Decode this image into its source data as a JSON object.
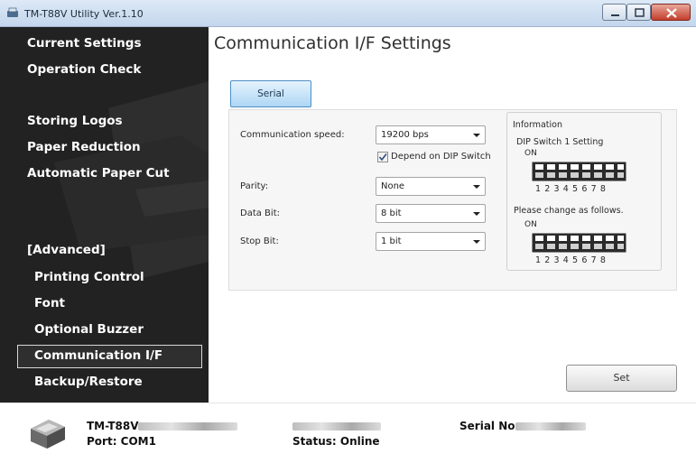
{
  "window": {
    "title": "TM-T88V Utility Ver.1.10"
  },
  "sidebar": {
    "items": [
      {
        "label": "Current Settings"
      },
      {
        "label": "Operation Check"
      },
      {
        "label": "Storing Logos"
      },
      {
        "label": "Paper Reduction"
      },
      {
        "label": "Automatic Paper Cut"
      },
      {
        "label": "[Advanced]"
      },
      {
        "label": "Printing Control"
      },
      {
        "label": "Font"
      },
      {
        "label": "Optional Buzzer"
      },
      {
        "label": "Communication I/F",
        "selected": true
      },
      {
        "label": "Backup/Restore"
      }
    ]
  },
  "main": {
    "title": "Communication I/F Settings",
    "tab": "Serial",
    "fields": {
      "speed": {
        "label": "Communication speed:",
        "value": "19200 bps"
      },
      "depend_dip": {
        "label": "Depend on DIP Switch",
        "checked": true
      },
      "parity": {
        "label": "Parity:",
        "value": "None"
      },
      "databit": {
        "label": "Data Bit:",
        "value": "8 bit"
      },
      "stopbit": {
        "label": "Stop Bit:",
        "value": "1 bit"
      }
    },
    "info": {
      "heading": "Information",
      "dip_setting": "DIP Switch 1 Setting",
      "on1": "ON",
      "numbers1": "1 2 3 4 5 6 7 8",
      "change_text": "Please change as follows.",
      "on2": "ON",
      "numbers2": "1 2 3 4 5 6 7 8"
    },
    "set_button": "Set"
  },
  "footer": {
    "model": "TM-T88V",
    "port": "Port: COM1",
    "status": "Status: Online",
    "serial_label": "Serial No:"
  },
  "colors": {
    "sidebar_bg": "#222222",
    "tab_accent": "#aed7f5",
    "close_red": "#c43e2a"
  },
  "icons": [
    "app-icon",
    "minimize-icon",
    "maximize-icon",
    "close-icon",
    "dropdown-arrow-icon",
    "checkmark-icon",
    "printer-icon"
  ]
}
